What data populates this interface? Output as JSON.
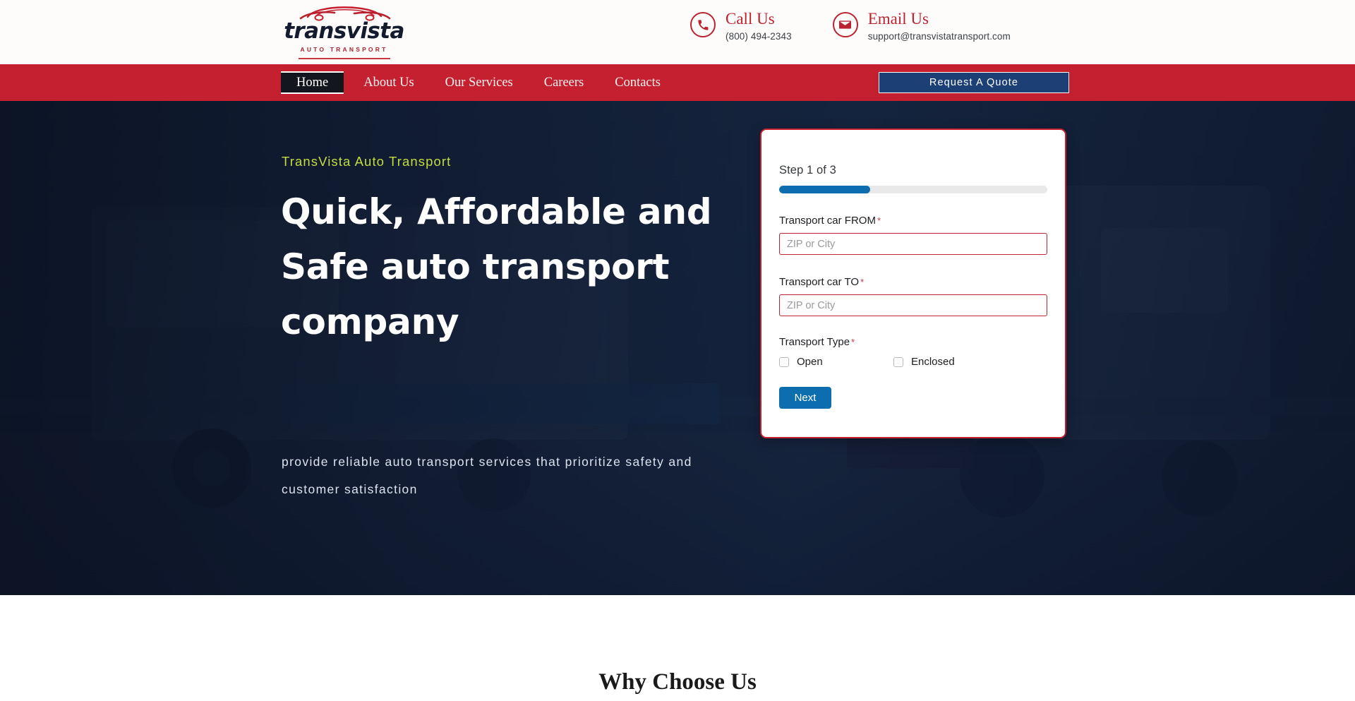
{
  "brand": {
    "name": "transvista",
    "tagline": "AUTO TRANSPORT"
  },
  "header": {
    "contacts": [
      {
        "icon": "phone-icon",
        "title": "Call Us",
        "value": "(800) 494-2343"
      },
      {
        "icon": "envelope-icon",
        "title": "Email Us",
        "value": "support@transvistatransport.com"
      }
    ]
  },
  "nav": {
    "items": [
      {
        "label": "Home",
        "active": true
      },
      {
        "label": "About Us",
        "active": false
      },
      {
        "label": "Our Services",
        "active": false
      },
      {
        "label": "Careers",
        "active": false
      },
      {
        "label": "Contacts",
        "active": false
      }
    ],
    "cta_label": "Request A Quote"
  },
  "hero": {
    "eyebrow": "TransVista Auto Transport",
    "title": "Quick, Affordable and Safe auto transport company",
    "subtitle": "provide reliable auto transport services that prioritize safety and customer satisfaction"
  },
  "quote_form": {
    "step_label": "Step 1 of 3",
    "progress_percent": 34,
    "fields": [
      {
        "label": "Transport car FROM",
        "required_mark": "*",
        "placeholder": "ZIP or City",
        "value": ""
      },
      {
        "label": "Transport car TO",
        "required_mark": "*",
        "placeholder": "ZIP or City",
        "value": ""
      }
    ],
    "transport_type": {
      "label": "Transport Type",
      "required_mark": "*",
      "options": [
        {
          "label": "Open",
          "checked": false
        },
        {
          "label": "Enclosed",
          "checked": false
        }
      ]
    },
    "next_label": "Next"
  },
  "section": {
    "why_choose_us": "Why Choose Us"
  },
  "colors": {
    "brand_red": "#c4202f",
    "nav_navy": "#1c3f75",
    "accent_green": "#c3dd41",
    "progress_blue": "#0d6eaf",
    "hero_navy": "#14203a"
  }
}
